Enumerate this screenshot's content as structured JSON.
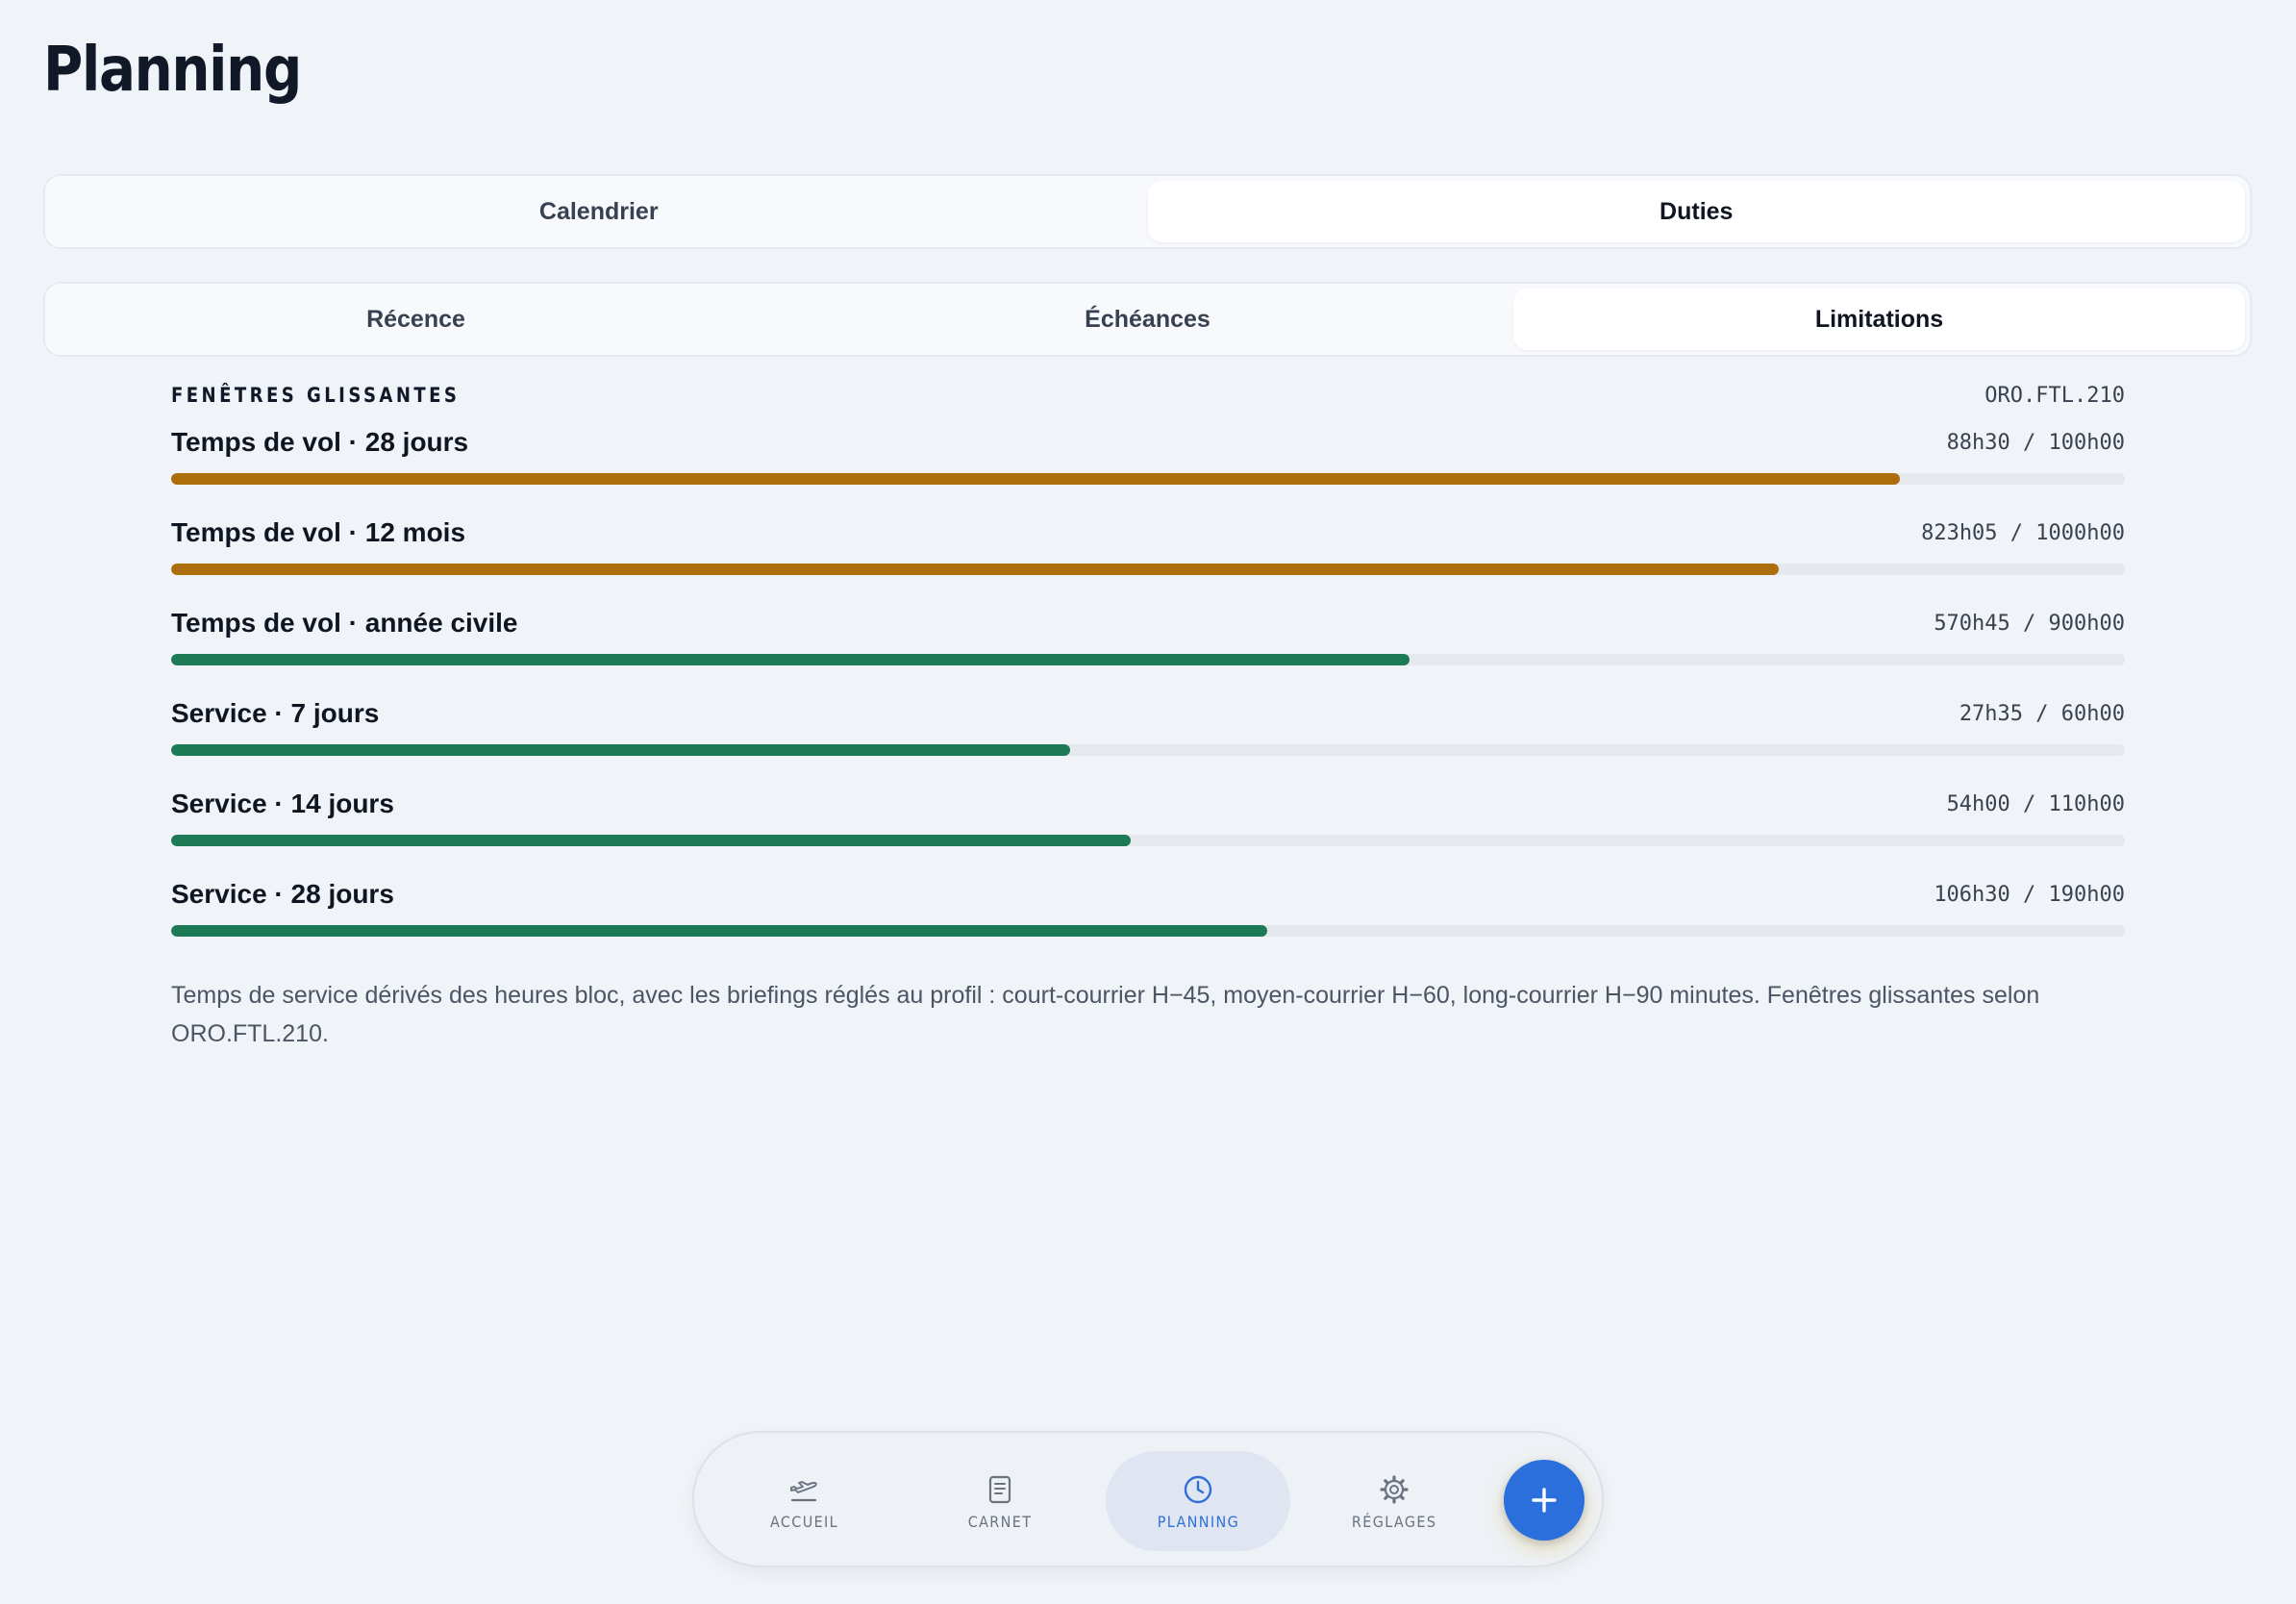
{
  "page": {
    "title": "Planning"
  },
  "tabs": {
    "main": [
      "Calendrier",
      "Duties"
    ],
    "main_active": 1,
    "sub": [
      "Récence",
      "Échéances",
      "Limitations"
    ],
    "sub_active": 2
  },
  "section": {
    "title": "FENÊTRES GLISSANTES",
    "reference": "ORO.FTL.210"
  },
  "colors": {
    "warning": "#ab6e0a",
    "ok": "#1d7a57",
    "accent": "#2b6fdd",
    "track": "#e5e8ec"
  },
  "limits": [
    {
      "label": "Temps de vol · 28 jours",
      "value": "88h30 / 100h00",
      "progress": 0.885,
      "status": "warning"
    },
    {
      "label": "Temps de vol · 12 mois",
      "value": "823h05 / 1000h00",
      "progress": 0.823,
      "status": "warning"
    },
    {
      "label": "Temps de vol · année civile",
      "value": "570h45 / 900h00",
      "progress": 0.634,
      "status": "ok"
    },
    {
      "label": "Service · 7 jours",
      "value": "27h35 / 60h00",
      "progress": 0.46,
      "status": "ok"
    },
    {
      "label": "Service · 14 jours",
      "value": "54h00 / 110h00",
      "progress": 0.491,
      "status": "ok"
    },
    {
      "label": "Service · 28 jours",
      "value": "106h30 / 190h00",
      "progress": 0.561,
      "status": "ok"
    }
  ],
  "footnote": "Temps de service dérivés des heures bloc, avec les briefings réglés au profil : court-courrier H−45, moyen-courrier H−60, long-courrier H−90 minutes. Fenêtres glissantes selon ORO.FTL.210.",
  "nav": {
    "items": [
      {
        "label": "ACCUEIL",
        "icon": "plane-takeoff-icon"
      },
      {
        "label": "CARNET",
        "icon": "notebook-icon"
      },
      {
        "label": "PLANNING",
        "icon": "clock-icon"
      },
      {
        "label": "RÉGLAGES",
        "icon": "gear-icon"
      }
    ],
    "active": 2,
    "fab_icon": "plus-icon"
  }
}
